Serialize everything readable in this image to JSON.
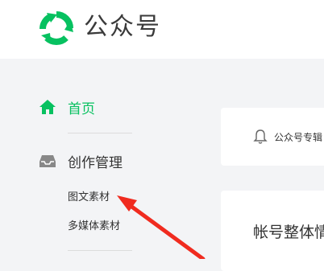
{
  "header": {
    "brand_name": "公众号",
    "logo_icon": "wechat-mp-logo-icon",
    "brand_color": "#07c160"
  },
  "sidebar": {
    "home": {
      "label": "首页",
      "icon": "home-icon",
      "active": true
    },
    "content_management": {
      "label": "创作管理",
      "icon": "inbox-icon",
      "items": [
        {
          "label": "图文素材"
        },
        {
          "label": "多媒体素材"
        }
      ]
    }
  },
  "main": {
    "notice": {
      "icon": "bell-icon",
      "text": "公众号专辑"
    },
    "overview": {
      "title": "帐号整体情"
    }
  },
  "annotation": {
    "type": "red-arrow",
    "color": "#f02b1f",
    "target": "图文素材"
  }
}
